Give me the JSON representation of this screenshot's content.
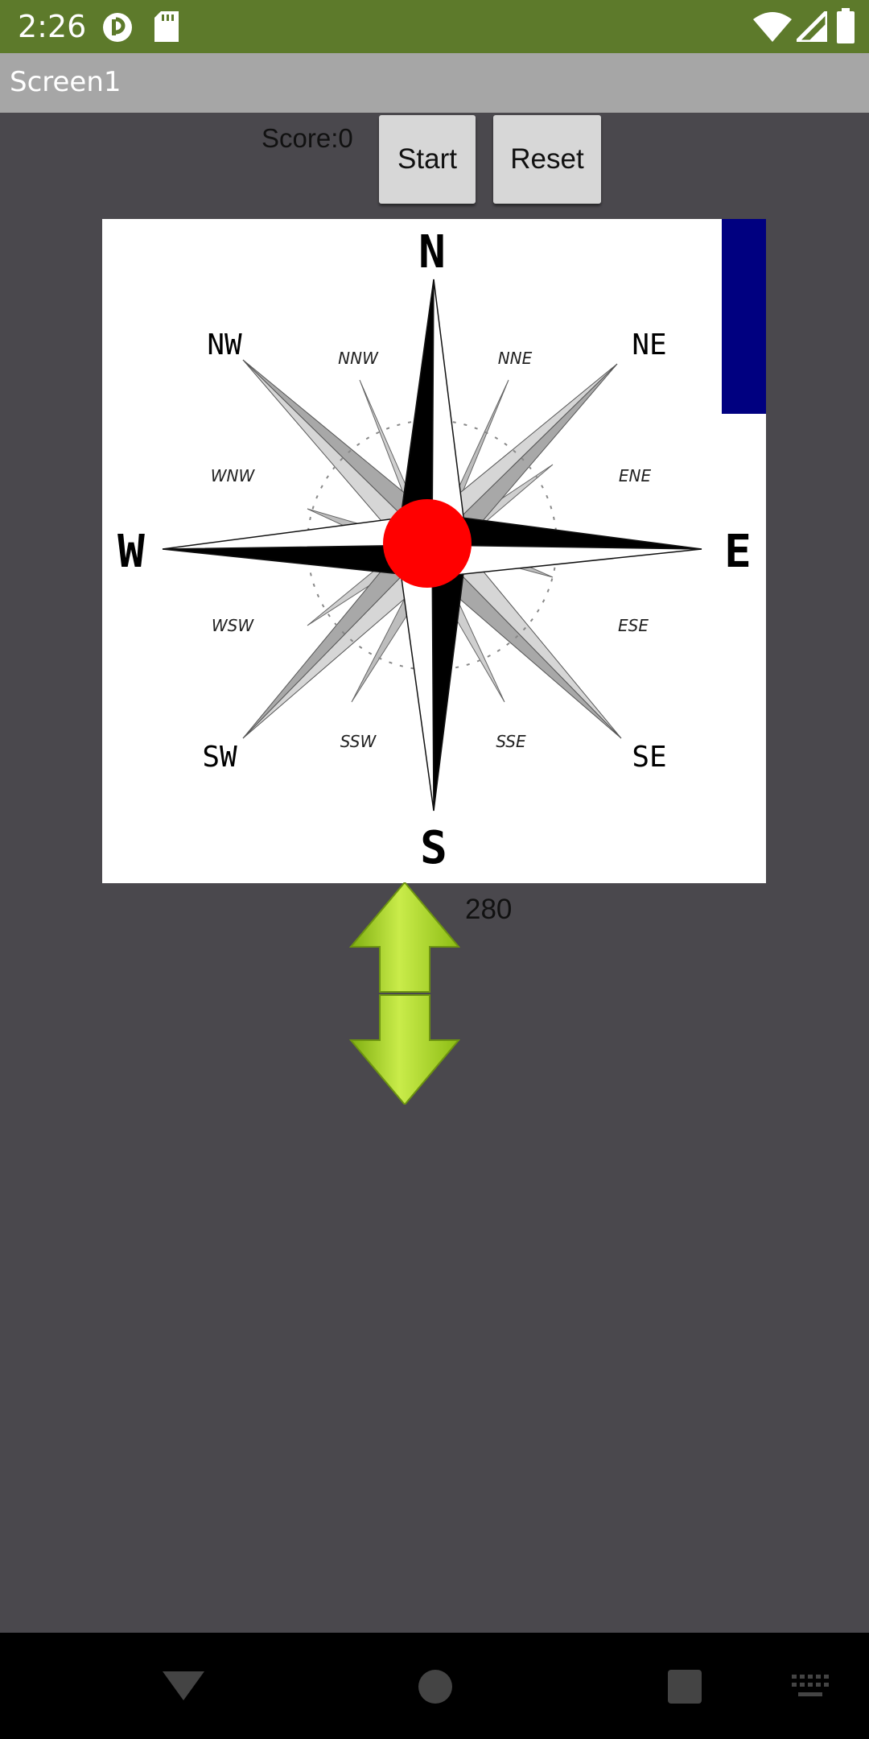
{
  "status_bar": {
    "time": "2:26",
    "icons": [
      "notification-icon",
      "sd-card-icon",
      "wifi-icon",
      "cell-signal-icon",
      "battery-icon"
    ]
  },
  "app": {
    "title": "Screen1"
  },
  "controls": {
    "score_label": "Score:0",
    "start_label": "Start",
    "reset_label": "Reset",
    "value_label": "280"
  },
  "compass": {
    "cardinal": {
      "n": "N",
      "e": "E",
      "s": "S",
      "w": "W"
    },
    "intercardinal": {
      "ne": "NE",
      "se": "SE",
      "sw": "SW",
      "nw": "NW"
    },
    "secondary": {
      "nne": "NNE",
      "ene": "ENE",
      "ese": "ESE",
      "sse": "SSE",
      "ssw": "SSW",
      "wsw": "WSW",
      "wnw": "WNW",
      "nnw": "NNW"
    }
  },
  "colors": {
    "status_bar": "#5d7a2b",
    "title_bar": "#a6a6a6",
    "background": "#4a484d",
    "ball": "#ff0000",
    "blue_bar": "#000080",
    "arrow": "#a6d31d"
  },
  "nav_bar": {
    "icons": [
      "back-icon",
      "home-icon",
      "recents-icon",
      "keyboard-icon"
    ]
  }
}
